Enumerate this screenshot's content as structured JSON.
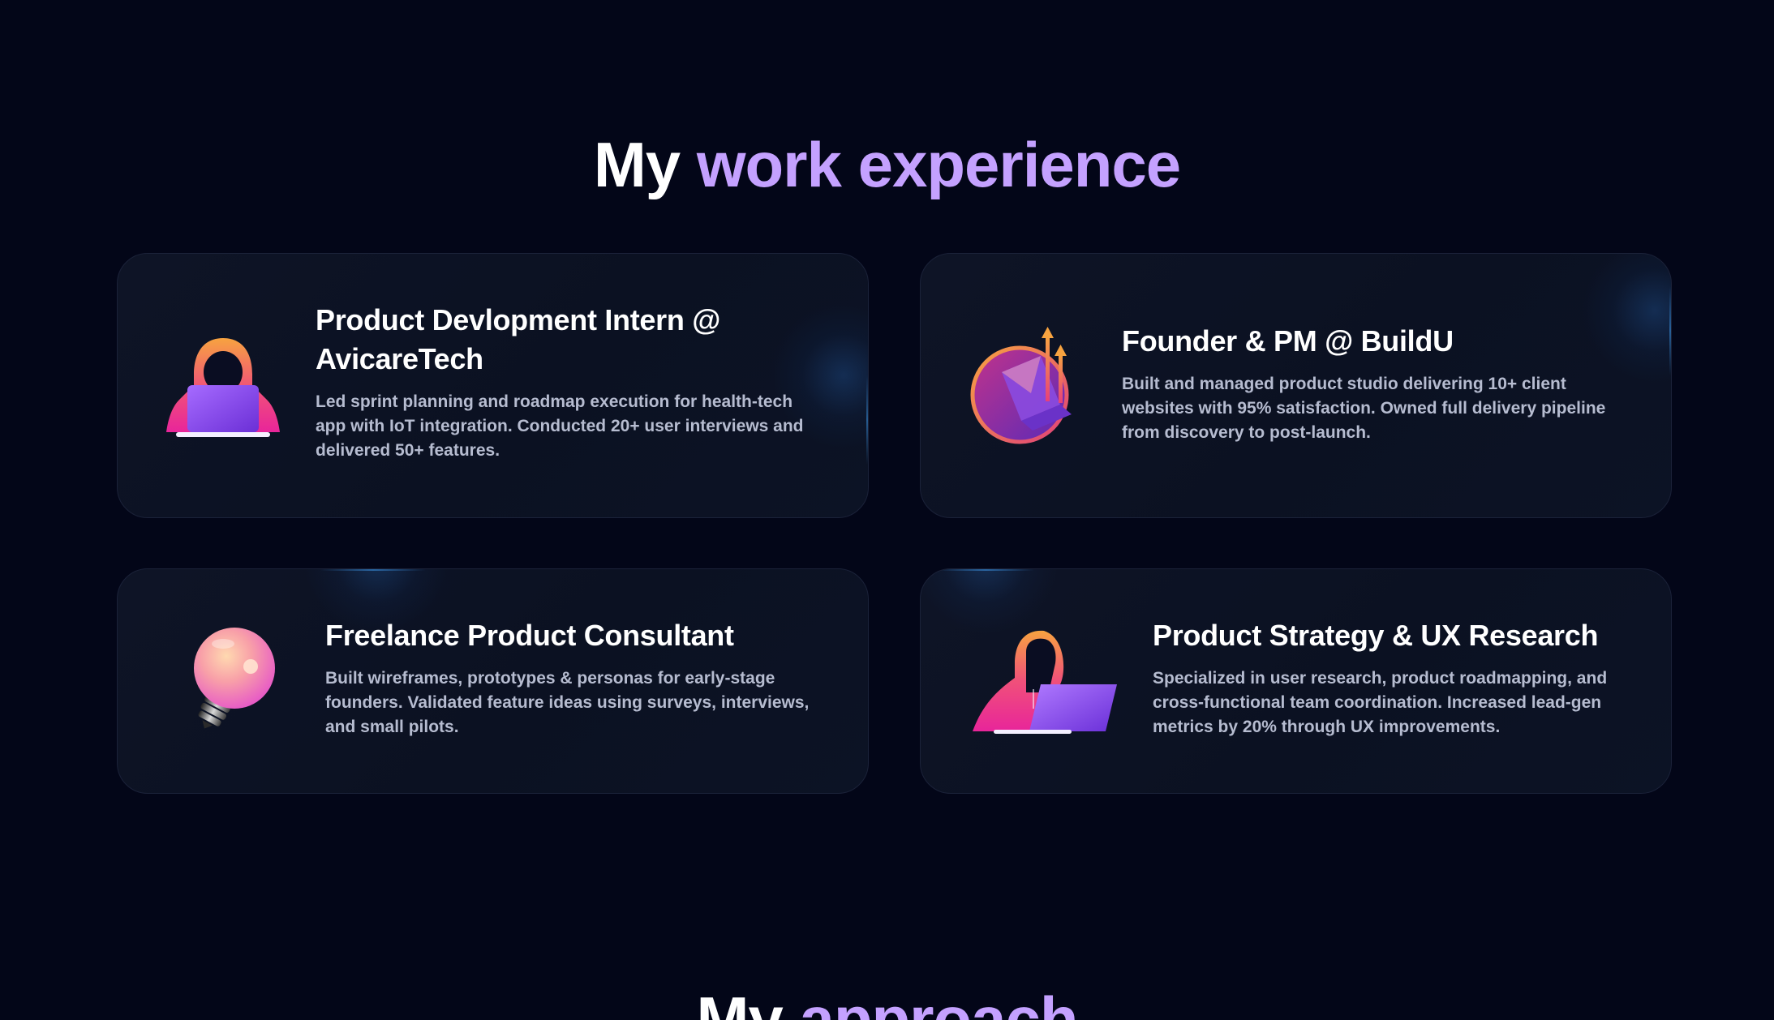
{
  "work_section": {
    "title_prefix": "My",
    "title_accent": "work experience"
  },
  "cards": [
    {
      "title": "Product Devlopment Intern @ AvicareTech",
      "description": "Led sprint planning and roadmap execution for health-tech app with IoT integration. Conducted 20+ user interviews and delivered 50+ features.",
      "icon": "hooded-person-laptop-icon"
    },
    {
      "title": "Founder & PM @ BuildU",
      "description": "Built and managed product studio delivering 10+ client websites with 95% satisfaction. Owned full delivery pipeline from discovery to post-launch.",
      "icon": "growth-chart-laptop-icon"
    },
    {
      "title": "Freelance Product Consultant",
      "description": "Built wireframes, prototypes & personas for early-stage founders. Validated feature ideas using surveys, interviews, and small pilots.",
      "icon": "lightbulb-icon"
    },
    {
      "title": "Product Strategy & UX Research",
      "description": "Specialized in user research, product roadmapping, and cross-functional team coordination. Increased lead-gen metrics by 20% through UX improvements.",
      "icon": "person-working-laptop-icon"
    }
  ],
  "approach_section": {
    "title_prefix": "My",
    "title_accent": "approach"
  },
  "colors": {
    "background": "#030618",
    "accent": "#c4a1ff",
    "card_bg": "#0c1224",
    "card_border": "#1b2239",
    "text_primary": "#ffffff",
    "text_secondary": "#b6bcd0"
  }
}
